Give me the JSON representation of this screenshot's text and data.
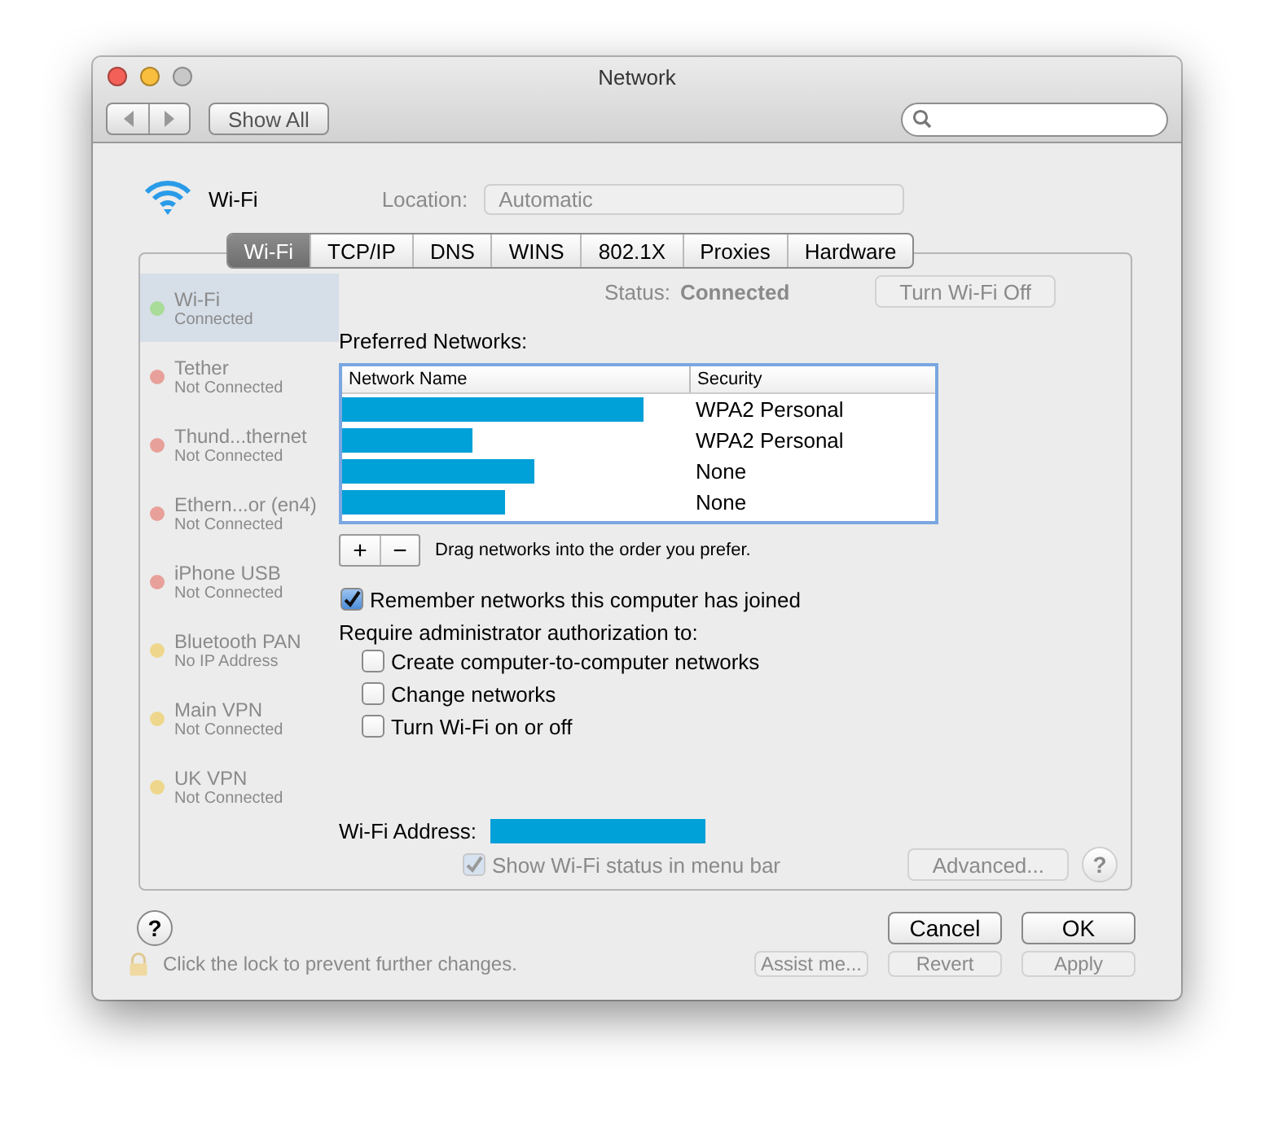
{
  "window": {
    "title": "Network"
  },
  "toolbar": {
    "show_all": "Show All"
  },
  "background_pane": {
    "location_label": "Location:",
    "location_value": "Automatic",
    "services": [
      {
        "name": "Wi-Fi",
        "status": "Connected",
        "color": "#a8dc98",
        "selected": true
      },
      {
        "name": "Tether",
        "status": "Not Connected",
        "color": "#e8a09a",
        "selected": false
      },
      {
        "name": "Thund...thernet",
        "status": "Not Connected",
        "color": "#e8a09a",
        "selected": false
      },
      {
        "name": "Ethern...or (en4)",
        "status": "Not Connected",
        "color": "#e8a09a",
        "selected": false
      },
      {
        "name": "iPhone USB",
        "status": "Not Connected",
        "color": "#e8a09a",
        "selected": false
      },
      {
        "name": "Bluetooth PAN",
        "status": "No IP Address",
        "color": "#eed78c",
        "selected": false
      },
      {
        "name": "Main VPN",
        "status": "Not Connected",
        "color": "#eed78c",
        "selected": false
      },
      {
        "name": "UK VPN",
        "status": "Not Connected",
        "color": "#eed78c",
        "selected": false
      }
    ],
    "status_label": "Status:",
    "status_value": "Connected",
    "turn_off_button": "Turn Wi-Fi Off",
    "show_status": {
      "label": "Show Wi-Fi status in menu bar",
      "checked": true
    },
    "advanced_button": "Advanced...",
    "help": "?",
    "lock_text": "Click the lock to prevent further changes.",
    "buttons": [
      "Assist me...",
      "Revert",
      "Apply"
    ]
  },
  "sheet": {
    "title": "Wi-Fi",
    "tabs": [
      {
        "label": "Wi-Fi",
        "selected": true
      },
      {
        "label": "TCP/IP",
        "selected": false
      },
      {
        "label": "DNS",
        "selected": false
      },
      {
        "label": "WINS",
        "selected": false
      },
      {
        "label": "802.1X",
        "selected": false
      },
      {
        "label": "Proxies",
        "selected": false
      },
      {
        "label": "Hardware",
        "selected": false
      }
    ],
    "preferred_label": "Preferred Networks:",
    "columns": [
      "Network Name",
      "Security"
    ],
    "networks": [
      {
        "security": "WPA2 Personal"
      },
      {
        "security": "WPA2 Personal"
      },
      {
        "security": "None"
      },
      {
        "security": "None"
      }
    ],
    "add": "+",
    "remove": "−",
    "drag_hint": "Drag networks into the order you prefer.",
    "remember": {
      "label": "Remember networks this computer has joined",
      "checked": true
    },
    "require_label": "Require administrator authorization to:",
    "require_options": [
      {
        "label": "Create computer-to-computer networks",
        "checked": false
      },
      {
        "label": "Change networks",
        "checked": false
      },
      {
        "label": "Turn Wi-Fi on or off",
        "checked": false
      }
    ],
    "address_label": "Wi-Fi Address:",
    "help": "?",
    "buttons": [
      "Cancel",
      "OK"
    ]
  }
}
